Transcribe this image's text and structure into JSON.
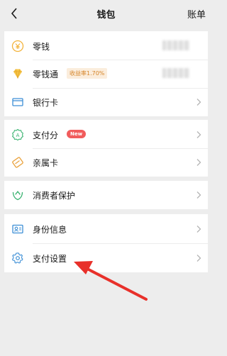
{
  "nav": {
    "title": "钱包",
    "right_label": "账单"
  },
  "groups": [
    {
      "items": [
        {
          "label": "零钱",
          "icon": "coin-icon"
        },
        {
          "label": "零钱通",
          "icon": "diamond-icon",
          "tag": "收益率1.70%"
        },
        {
          "label": "银行卡",
          "icon": "bank-card-icon"
        }
      ]
    },
    {
      "items": [
        {
          "label": "支付分",
          "icon": "pay-score-icon",
          "badge": "New"
        },
        {
          "label": "亲属卡",
          "icon": "family-card-icon"
        }
      ]
    },
    {
      "items": [
        {
          "label": "消费者保护",
          "icon": "consumer-protection-icon"
        }
      ]
    },
    {
      "items": [
        {
          "label": "身份信息",
          "icon": "id-info-icon"
        },
        {
          "label": "支付设置",
          "icon": "gear-icon"
        }
      ]
    }
  ],
  "colors": {
    "background": "#ededed",
    "accent_green": "#3ab371",
    "coin_yellow": "#f3b33b",
    "tag_orange": "#d6852a",
    "badge_red": "#f15c5c",
    "arrow_red": "#e8302a"
  }
}
